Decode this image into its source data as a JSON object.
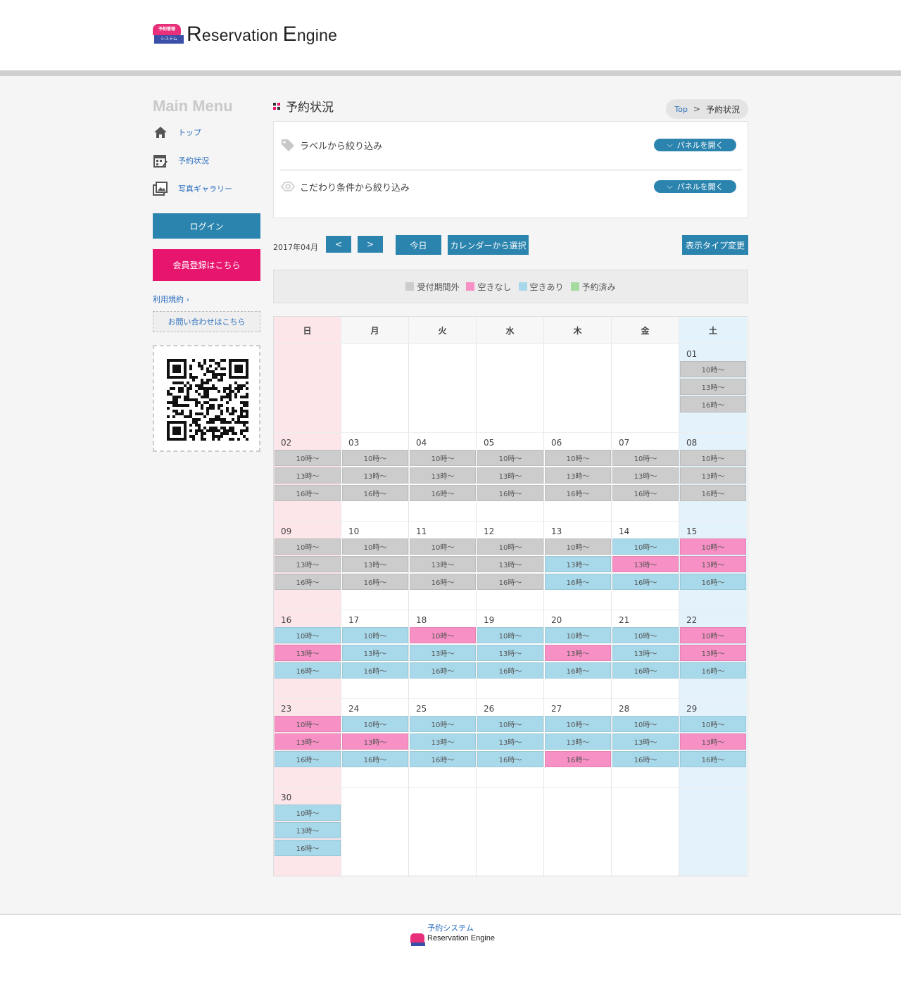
{
  "header": {
    "logo_badge_top": "予約管理",
    "logo_badge_bottom": "システム",
    "logo_r": "R",
    "logo_rest1": "eservation ",
    "logo_e": "E",
    "logo_rest2": "ngine"
  },
  "sidebar": {
    "title": "Main Menu",
    "items": [
      {
        "label": "トップ",
        "icon": "home-icon"
      },
      {
        "label": "予約状況",
        "icon": "calendar-icon"
      },
      {
        "label": "写真ギャラリー",
        "icon": "photo-icon"
      }
    ],
    "login": "ログイン",
    "register": "会員登録はこちら",
    "terms": "利用規約",
    "contact": "お問い合わせはこちら"
  },
  "main": {
    "title": "予約状況",
    "breadcrumb": {
      "top": "Top",
      "sep": ">",
      "current": "予約状況"
    },
    "filters": [
      {
        "label": "ラベルから絞り込み",
        "button": "パネルを開く"
      },
      {
        "label": "こだわり条件から絞り込み",
        "button": "パネルを開く"
      }
    ],
    "nav": {
      "month": "2017年04月",
      "prev": "<",
      "next": ">",
      "today": "今日",
      "pick": "カレンダーから選択",
      "display_type": "表示タイプ変更"
    },
    "legend": [
      {
        "label": "受付期間外",
        "color": "#cccccc"
      },
      {
        "label": "空きなし",
        "color": "#f790c4"
      },
      {
        "label": "空きあり",
        "color": "#a8d9ea"
      },
      {
        "label": "予約済み",
        "color": "#a6dba0"
      }
    ],
    "weekdays": [
      "日",
      "月",
      "火",
      "水",
      "木",
      "金",
      "土"
    ],
    "slot_labels": [
      "10時～",
      "13時～",
      "16時～"
    ],
    "weeks": [
      [
        null,
        null,
        null,
        null,
        null,
        null,
        {
          "d": "01",
          "s": [
            "out",
            "out",
            "out"
          ]
        }
      ],
      [
        {
          "d": "02",
          "s": [
            "out",
            "out",
            "out"
          ]
        },
        {
          "d": "03",
          "s": [
            "out",
            "out",
            "out"
          ]
        },
        {
          "d": "04",
          "s": [
            "out",
            "out",
            "out"
          ]
        },
        {
          "d": "05",
          "s": [
            "out",
            "out",
            "out"
          ]
        },
        {
          "d": "06",
          "s": [
            "out",
            "out",
            "out"
          ]
        },
        {
          "d": "07",
          "s": [
            "out",
            "out",
            "out"
          ]
        },
        {
          "d": "08",
          "s": [
            "out",
            "out",
            "out"
          ]
        }
      ],
      [
        {
          "d": "09",
          "s": [
            "out",
            "out",
            "out"
          ]
        },
        {
          "d": "10",
          "s": [
            "out",
            "out",
            "out"
          ]
        },
        {
          "d": "11",
          "s": [
            "out",
            "out",
            "out"
          ]
        },
        {
          "d": "12",
          "s": [
            "out",
            "out",
            "out"
          ]
        },
        {
          "d": "13",
          "s": [
            "out",
            "open",
            "open"
          ]
        },
        {
          "d": "14",
          "s": [
            "open",
            "full",
            "open"
          ]
        },
        {
          "d": "15",
          "s": [
            "full",
            "full",
            "open"
          ]
        }
      ],
      [
        {
          "d": "16",
          "s": [
            "open",
            "full",
            "open"
          ]
        },
        {
          "d": "17",
          "s": [
            "open",
            "open",
            "open"
          ]
        },
        {
          "d": "18",
          "s": [
            "full",
            "open",
            "open"
          ]
        },
        {
          "d": "19",
          "s": [
            "open",
            "open",
            "open"
          ]
        },
        {
          "d": "20",
          "s": [
            "open",
            "full",
            "open"
          ]
        },
        {
          "d": "21",
          "s": [
            "open",
            "open",
            "open"
          ]
        },
        {
          "d": "22",
          "s": [
            "full",
            "full",
            "open"
          ]
        }
      ],
      [
        {
          "d": "23",
          "s": [
            "full",
            "full",
            "open"
          ]
        },
        {
          "d": "24",
          "s": [
            "open",
            "full",
            "open"
          ]
        },
        {
          "d": "25",
          "s": [
            "open",
            "open",
            "open"
          ]
        },
        {
          "d": "26",
          "s": [
            "open",
            "open",
            "open"
          ]
        },
        {
          "d": "27",
          "s": [
            "open",
            "open",
            "full"
          ]
        },
        {
          "d": "28",
          "s": [
            "open",
            "open",
            "open"
          ]
        },
        {
          "d": "29",
          "s": [
            "open",
            "full",
            "open"
          ]
        }
      ],
      [
        {
          "d": "30",
          "s": [
            "open",
            "open",
            "open"
          ]
        },
        null,
        null,
        null,
        null,
        null,
        null
      ]
    ]
  },
  "footer": {
    "title": "予約システム",
    "logo_text": "Reservation Engine"
  }
}
